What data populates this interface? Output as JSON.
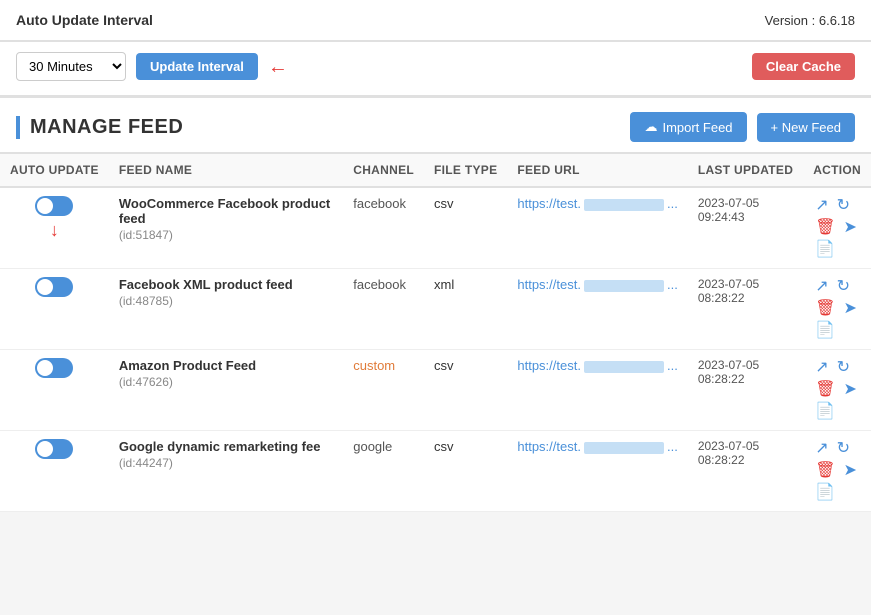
{
  "header": {
    "title": "Auto Update Interval",
    "version": "Version : 6.6.18",
    "interval_label": "30 Minutes",
    "update_btn": "Update Interval",
    "clear_cache_btn": "Clear Cache"
  },
  "manage": {
    "title": "MANAGE FEED",
    "import_btn": "Import Feed",
    "new_btn": "+ New Feed"
  },
  "table": {
    "columns": [
      "AUTO UPDATE",
      "FEED NAME",
      "CHANNEL",
      "FILE TYPE",
      "FEED URL",
      "LAST UPDATED",
      "ACTION"
    ],
    "rows": [
      {
        "id": 1,
        "auto_update": true,
        "has_down_arrow": true,
        "feed_name": "WooCommerce Facebook product feed",
        "feed_id": "(id:51847)",
        "channel": "facebook",
        "channel_type": "normal",
        "file_type": "csv",
        "feed_url_prefix": "https://test.",
        "feed_url_suffix": "...",
        "last_updated_date": "2023-07-05",
        "last_updated_time": "09:24:43"
      },
      {
        "id": 2,
        "auto_update": true,
        "has_down_arrow": false,
        "feed_name": "Facebook XML product feed",
        "feed_id": "(id:48785)",
        "channel": "facebook",
        "channel_type": "normal",
        "file_type": "xml",
        "feed_url_prefix": "https://test.",
        "feed_url_suffix": "...",
        "last_updated_date": "2023-07-05",
        "last_updated_time": "08:28:22"
      },
      {
        "id": 3,
        "auto_update": true,
        "has_down_arrow": false,
        "feed_name": "Amazon Product Feed",
        "feed_id": "(id:47626)",
        "channel": "custom",
        "channel_type": "custom",
        "file_type": "csv",
        "feed_url_prefix": "https://test.",
        "feed_url_suffix": "...",
        "last_updated_date": "2023-07-05",
        "last_updated_time": "08:28:22"
      },
      {
        "id": 4,
        "auto_update": true,
        "has_down_arrow": false,
        "feed_name": "Google dynamic remarketing fee",
        "feed_id": "(id:44247)",
        "channel": "google",
        "channel_type": "normal",
        "file_type": "csv",
        "feed_url_prefix": "https://test.",
        "feed_url_suffix": "...",
        "last_updated_date": "2023-07-05",
        "last_updated_time": "08:28:22"
      }
    ]
  },
  "icons": {
    "export": "↗",
    "refresh": "↻",
    "delete": "🗑",
    "clone": "➤",
    "doc": "📄",
    "cloud": "☁",
    "plus": "+"
  }
}
